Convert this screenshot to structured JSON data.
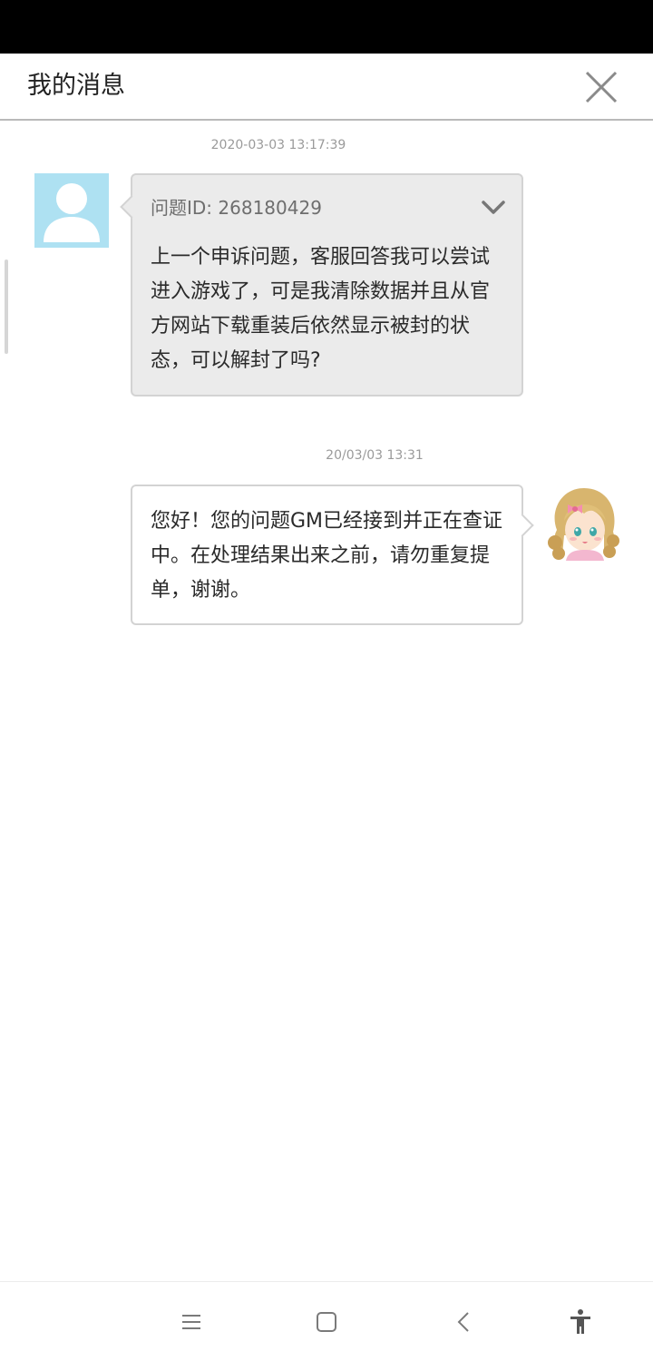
{
  "header": {
    "title": "我的消息",
    "close_icon": "close-icon"
  },
  "messages": [
    {
      "timestamp": "2020-03-03 13:17:39",
      "sender": "user",
      "avatar_icon": "default-user-avatar-icon",
      "issue_id": "问题ID: 268180429",
      "expand_icon": "chevron-down-icon",
      "text": "上一个申诉问题，客服回答我可以尝试进入游戏了，可是我清除数据并且从官方网站下载重装后依然显示被封的状态，可以解封了吗?"
    },
    {
      "timestamp": "20/03/03 13:31",
      "sender": "gm",
      "avatar_icon": "gm-girl-avatar-icon",
      "text": "您好！您的问题GM已经接到并正在查证中。在处理结果出来之前，请勿重复提单，谢谢。"
    }
  ],
  "navbar": {
    "icons": [
      "menu-icon",
      "home-icon",
      "back-icon",
      "accessibility-icon"
    ]
  },
  "colors": {
    "status_bar": "#000000",
    "user_bubble": "#ebebeb",
    "gm_bubble": "#ffffff",
    "bubble_border": "#d3d3d3",
    "user_avatar_bg": "#aee1f2",
    "timestamp": "#9a9a9a"
  }
}
